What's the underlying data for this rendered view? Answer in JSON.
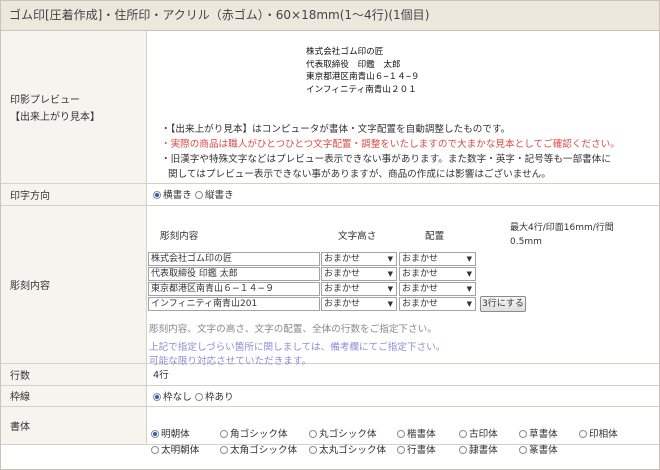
{
  "header": {
    "title": "ゴム印[圧着作成]・住所印・アクリル（赤ゴム）・60×18mm(1〜4行)(1個目)"
  },
  "preview": {
    "label_line1": "印影プレビュー",
    "label_line2": "【出来上がり見本】",
    "image_lines": [
      "株式会社ゴム印の匠",
      "代表取締役　印鑑　太郎",
      "東京都港区南青山６−１４−９",
      "インフィニティ南青山２０１"
    ],
    "notes": [
      "・【出来上がり見本】はコンピュータが書体・文字配置を自動調整したものです。",
      "・実際の商品は職人がひとつひとつ文字配置・調整をいたしますので大まかな見本としてご確認ください。",
      "・旧漢字や特殊文字などはプレビュー表示できない事があります。また数字・英字・記号等も一部書体に",
      "関してはプレビュー表示できない事がありますが、商品の作成には影響はございません。"
    ]
  },
  "direction": {
    "label": "印字方向",
    "options": [
      "横書き",
      "縦書き"
    ],
    "selected": "横書き"
  },
  "engraving": {
    "label": "彫刻内容",
    "col_content": "彫刻内容",
    "col_height": "文字高さ",
    "col_align": "配置",
    "max_info_line1": "最大4行/印面16mm/行間",
    "max_info_line2": "0.5mm",
    "rows": [
      {
        "text": "株式会社ゴム印の匠",
        "height": "おまかせ",
        "align": "おまかせ"
      },
      {
        "text": "代表取締役 印鑑 太郎",
        "height": "おまかせ",
        "align": "おまかせ"
      },
      {
        "text": "東京都港区南青山６−１４−９",
        "height": "おまかせ",
        "align": "おまかせ"
      },
      {
        "text": "インフィニティ南青山201",
        "height": "おまかせ",
        "align": "おまかせ"
      }
    ],
    "lines_button": "3行にする",
    "hint": "彫刻内容、文字の高さ、文字の配置、全体の行数をご指定下さい。",
    "note_line1": "上記で指定しづらい箇所に関しましては、備考欄にてご指定下さい。",
    "note_line2": "可能な限り対応させていただきます。"
  },
  "line_count": {
    "label": "行数",
    "value": "4行"
  },
  "frame": {
    "label": "枠線",
    "options": [
      "枠なし",
      "枠あり"
    ],
    "selected": "枠なし"
  },
  "font": {
    "label": "書体",
    "row1": [
      "明朝体",
      "角ゴシック体",
      "丸ゴシック体",
      "楷書体",
      "古印体",
      "草書体",
      "印相体"
    ],
    "row2": [
      "太明朝体",
      "太角ゴシック体",
      "太丸ゴシック体",
      "行書体",
      "隷書体",
      "篆書体"
    ],
    "selected": "明朝体"
  },
  "colors": {
    "header_bg": "#ece8de",
    "label_bg": "#f6f4ee",
    "warning": "#e04848",
    "note": "#8a8ed8"
  }
}
